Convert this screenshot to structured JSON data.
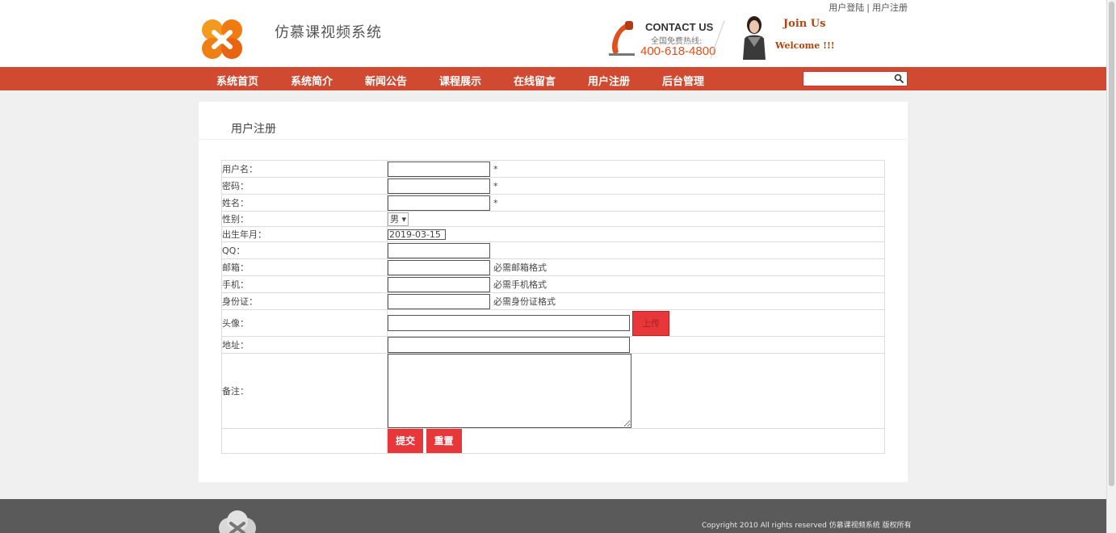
{
  "toplinks": {
    "login": "用户登陆",
    "sep": "|",
    "register": "用户注册"
  },
  "brand": {
    "site_name": "仿慕课视频系统",
    "logo_color": "#f08a1a"
  },
  "contact": {
    "title": "CONTACT US",
    "subtitle": "全国免费热线:",
    "phone": "400-618-4800"
  },
  "join": {
    "line1": "Join Us",
    "line2": "Welcome !!!"
  },
  "nav": {
    "items": [
      "系统首页",
      "系统简介",
      "新闻公告",
      "课程展示",
      "在线留言",
      "用户注册",
      "后台管理"
    ],
    "search_placeholder": "",
    "bg_color": "#d04a31"
  },
  "panel": {
    "title": "用户注册"
  },
  "form": {
    "username_label": "用户名：",
    "username_req": "*",
    "password_label": "密码：",
    "password_req": "*",
    "name_label": "姓名：",
    "name_req": "*",
    "gender_label": "性别：",
    "gender_value": "男 ▾",
    "birth_label": "出生年月：",
    "birth_value": "2019-03-15",
    "qq_label": "QQ：",
    "email_label": "邮箱：",
    "email_hint": "必需邮箱格式",
    "mobile_label": "手机：",
    "mobile_hint": "必需手机格式",
    "idcard_label": "身份证：",
    "idcard_hint": "必需身份证格式",
    "avatar_label": "头像：",
    "upload_label": "上传",
    "address_label": "地址：",
    "notes_label": "备注：",
    "submit_label": "提交",
    "reset_label": "重置",
    "button_color": "#e8373a"
  },
  "footer": {
    "copyright": "Copyright 2010 All rights reserved 仿慕课视频系统 版权所有"
  }
}
